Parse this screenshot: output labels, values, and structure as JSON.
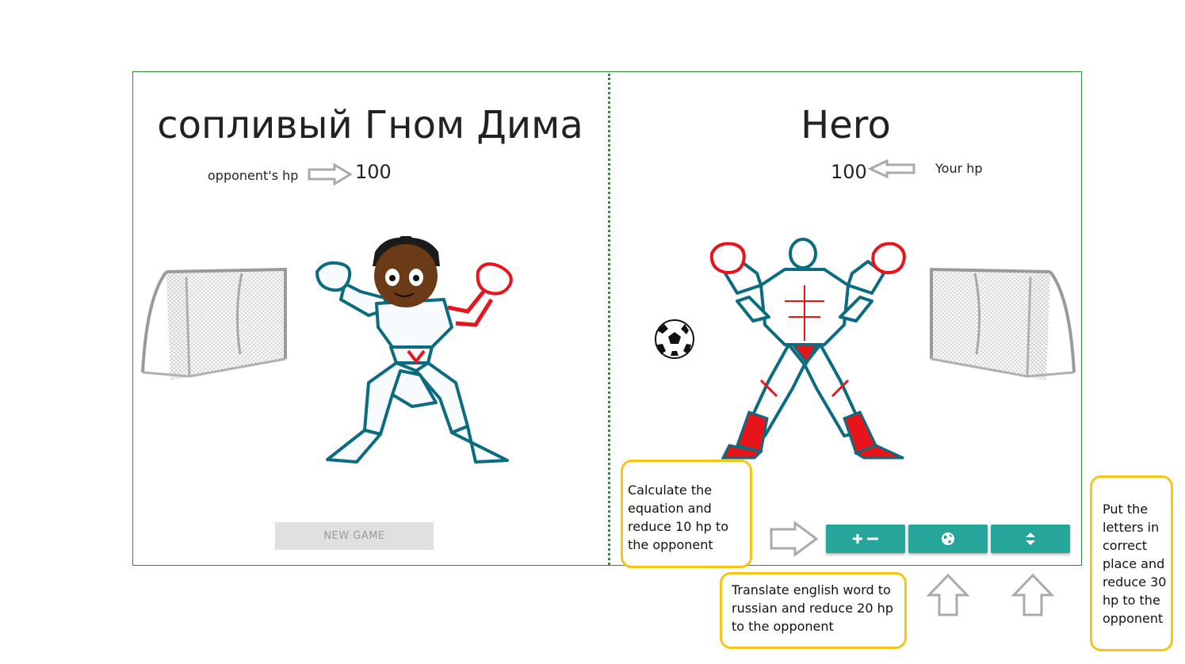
{
  "opponent": {
    "name": "сопливый Гном Дима",
    "hp_label": "opponent's hp",
    "hp": "100"
  },
  "hero": {
    "name": "Hero",
    "hp_label": "Your hp",
    "hp": "100"
  },
  "controls": {
    "new_game_label": "NEW GAME",
    "math_button_icon": "plus-minus-icon",
    "translate_button_icon": "globe-icon",
    "sort_button_icon": "sort-arrows-icon"
  },
  "callouts": {
    "math": "Calculate the equation and reduce 10 hp to the opponent",
    "translate": "Translate english word to russian and reduce 20 hp to the opponent",
    "letters": "Put the letters in correct place and reduce 30 hp to the opponent"
  },
  "colors": {
    "accent": "#26a69a",
    "border": "#2e8b3a",
    "callout_border": "#f5c518",
    "hero_red": "#e8141b",
    "outline_teal": "#0b6b7f"
  }
}
